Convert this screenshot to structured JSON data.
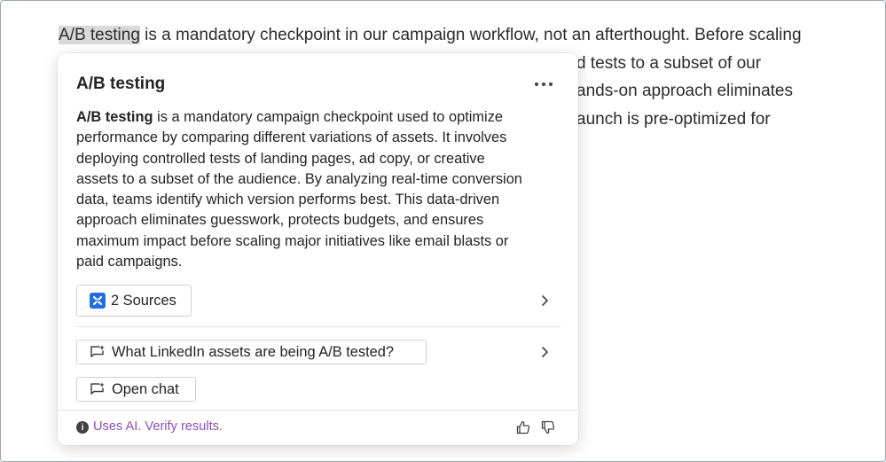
{
  "document": {
    "highlight": "A/B testing",
    "lines": [
      " is a mandatory checkpoint in our campaign workflow, not an afterthought. Before scaling",
      "d tests to a subset of our",
      "ands-on approach eliminates",
      "aunch is pre-optimized for"
    ]
  },
  "popup": {
    "title": "A/B testing",
    "more_label": "More options",
    "body": {
      "term": "A/B testing",
      "lines": [
        " is a mandatory campaign checkpoint used to optimize",
        "performance by comparing different variations of assets. It involves",
        "deploying controlled tests of landing pages, ad copy, or creative",
        "assets to a subset of the audience. By analyzing real-time conversion",
        "data, teams identify which version performs best. This data-driven",
        "approach eliminates guesswork, protects budgets, and ensures",
        "maximum impact before scaling major initiatives like email blasts or",
        "paid campaigns."
      ]
    },
    "sources": {
      "label": "2 Sources",
      "icon": "sources-app-icon",
      "icon_color": "#1f6fe0"
    },
    "suggestion": {
      "label": "What LinkedIn assets are being A/B tested?",
      "icon": "chat-sparkle-icon"
    },
    "open_chat": {
      "label": "Open chat",
      "icon": "chat-sparkle-icon"
    },
    "footer": {
      "disclaimer": "Uses AI. Verify results.",
      "disclaimer_color": "#8a4fb5",
      "info_icon": "info-icon",
      "thumbs_up_icon": "thumbs-up-icon",
      "thumbs_down_icon": "thumbs-down-icon"
    }
  }
}
